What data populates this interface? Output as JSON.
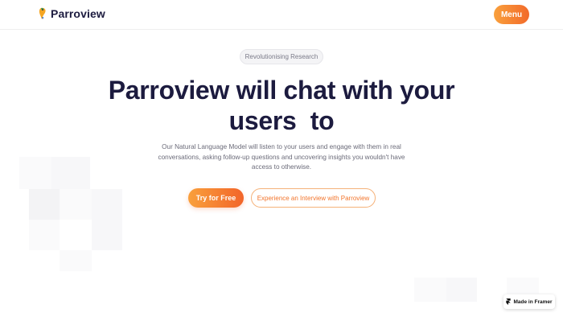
{
  "header": {
    "brand": "Parroview",
    "menu_label": "Menu"
  },
  "hero": {
    "pill": "Revolutionising Research",
    "headline_line1": "Parroview will chat with your",
    "headline_line2": "users  to",
    "subtitle": "Our Natural Language Model will listen to your users and engage with them in real conversations, asking follow-up questions and uncovering insights you wouldn't have access to otherwise.",
    "primary_cta": "Try for Free",
    "secondary_cta": "Experience an Interview with Parroview"
  },
  "badge": {
    "label": "Made in Framer"
  },
  "colors": {
    "accent_start": "#f9a03c",
    "accent_end": "#f2652a",
    "headline": "#1c1b3f",
    "body_text": "#6a6a78"
  },
  "icons": {
    "logo": "parrot-logo-icon",
    "framer": "framer-icon"
  }
}
